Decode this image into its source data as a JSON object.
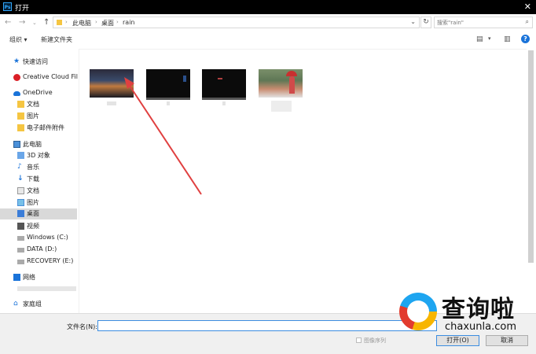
{
  "window": {
    "title": "打开",
    "app_icon": "Ps"
  },
  "address": {
    "crumbs": [
      "此电脑",
      "桌面",
      "rain"
    ],
    "search_placeholder": "搜索\"rain\""
  },
  "toolbar": {
    "organize": "组织 ▾",
    "new_folder": "新建文件夹"
  },
  "sidebar": {
    "items": [
      {
        "label": "快速访问",
        "icon": "star-icon"
      },
      {
        "label": "Creative Cloud Files",
        "icon": "creative-cloud-icon"
      },
      {
        "label": "OneDrive",
        "icon": "cloud-icon"
      },
      {
        "label": "文档",
        "icon": "folder-icon"
      },
      {
        "label": "图片",
        "icon": "folder-icon"
      },
      {
        "label": "电子邮件附件",
        "icon": "folder-icon"
      },
      {
        "label": "此电脑",
        "icon": "computer-icon"
      },
      {
        "label": "3D 对象",
        "icon": "3d-objects-icon"
      },
      {
        "label": "音乐",
        "icon": "music-icon"
      },
      {
        "label": "下载",
        "icon": "download-icon"
      },
      {
        "label": "文档",
        "icon": "document-icon"
      },
      {
        "label": "图片",
        "icon": "pictures-icon"
      },
      {
        "label": "桌面",
        "icon": "desktop-icon"
      },
      {
        "label": "视频",
        "icon": "video-icon"
      },
      {
        "label": "Windows (C:)",
        "icon": "drive-icon"
      },
      {
        "label": "DATA (D:)",
        "icon": "drive-icon"
      },
      {
        "label": "RECOVERY (E:)",
        "icon": "drive-icon"
      },
      {
        "label": "网络",
        "icon": "network-icon"
      },
      {
        "label": "家庭组",
        "icon": "homegroup-icon"
      }
    ],
    "selected": "桌面"
  },
  "bottom": {
    "filename_label": "文件名(N):",
    "filename_value": "",
    "image_sequence": "图像序列",
    "open_button": "打开(O)",
    "cancel_button": "取消"
  },
  "watermark": {
    "cn": "查询啦",
    "en": "chaxunla.com"
  },
  "colors": {
    "accent": "#3c8de0",
    "selection": "#d9d9d9",
    "arrow": "#e04040"
  }
}
